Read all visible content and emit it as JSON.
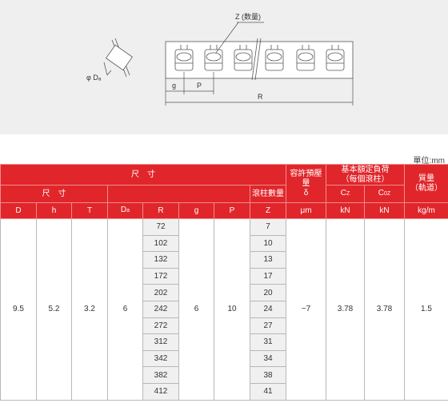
{
  "diagram": {
    "z_label": "Z (数量)",
    "dw_label": "φ Dₐ",
    "g_label": "g",
    "p_label": "P",
    "r_label": "R"
  },
  "unit": "單位:mm",
  "table": {
    "header": {
      "dimensions": "尺　寸",
      "dimensions_sub": "尺　寸",
      "clearance": "容許預壓量",
      "delta": "δ",
      "micron": "μm",
      "load_rating": "基本額定負荷",
      "load_rating_sub": "（每個滾柱）",
      "mass": "質量",
      "mass_sub": "（軌道）",
      "roller_count": "滾柱數量",
      "D": "D",
      "h": "h",
      "T": "T",
      "Da": "D",
      "Da_sub": "a",
      "R": "R",
      "g": "g",
      "P": "P",
      "Z": "Z",
      "C": "C",
      "C_sub": "Z",
      "C_unit": "kN",
      "C0": "C",
      "C0_sub": "0Z",
      "C0_unit": "kN",
      "mass_unit": "kg/m"
    },
    "fixed": {
      "D": "9.5",
      "h": "5.2",
      "T": "3.2",
      "Da": "6",
      "g": "6",
      "P": "10",
      "delta": "−7",
      "C": "3.78",
      "C0": "3.78",
      "mass": "1.5"
    },
    "rows": [
      {
        "R": "72",
        "Z": "7"
      },
      {
        "R": "102",
        "Z": "10"
      },
      {
        "R": "132",
        "Z": "13"
      },
      {
        "R": "172",
        "Z": "17"
      },
      {
        "R": "202",
        "Z": "20"
      },
      {
        "R": "242",
        "Z": "24"
      },
      {
        "R": "272",
        "Z": "27"
      },
      {
        "R": "312",
        "Z": "31"
      },
      {
        "R": "342",
        "Z": "34"
      },
      {
        "R": "382",
        "Z": "38"
      },
      {
        "R": "412",
        "Z": "41"
      }
    ]
  }
}
